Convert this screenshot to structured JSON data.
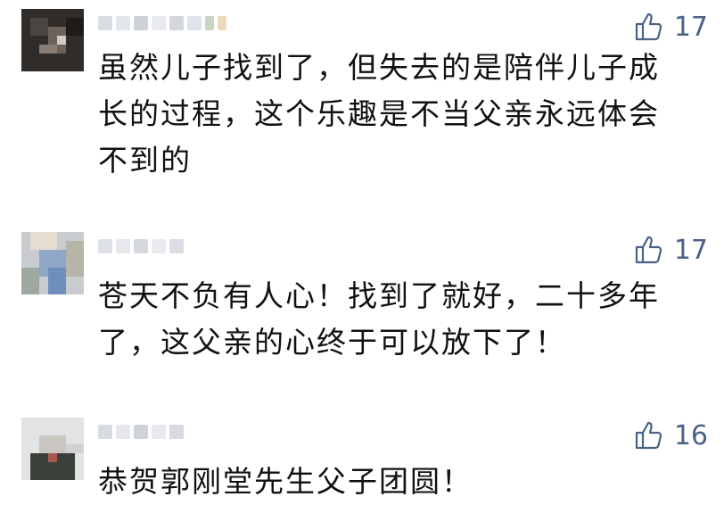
{
  "comments": [
    {
      "likes": "17",
      "text": "虽然儿子找到了，但失去的是陪伴儿子成\n长的过程，这个乐趣是不当父亲永远体会\n不到的"
    },
    {
      "likes": "17",
      "text": "苍天不负有人心！找到了就好，二十多年\n了，这父亲的心终于可以放下了！"
    },
    {
      "likes": "16",
      "text": "恭贺郭刚堂先生父子团圆！"
    }
  ],
  "colors": {
    "like_icon": "#4a6287",
    "text": "#111111"
  },
  "icons": {
    "like": "thumbs-up-icon"
  }
}
